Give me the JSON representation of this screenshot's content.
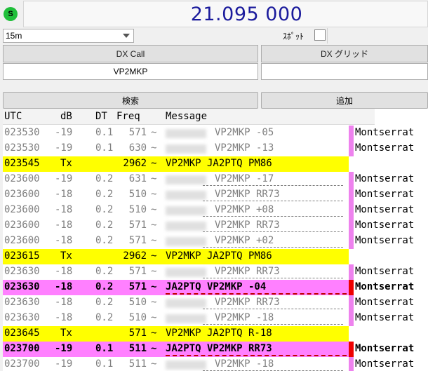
{
  "freq": {
    "indicator": "S",
    "value": "21.095 000"
  },
  "band": {
    "selected": "15m"
  },
  "spot": {
    "label": "ｽﾎﾟｯﾄ"
  },
  "dx": {
    "call_label": "DX Call",
    "grid_label": "DX グリッド",
    "call_value": "VP2MKP",
    "grid_value": ""
  },
  "actions": {
    "search": "検索",
    "add": "追加"
  },
  "table": {
    "headers": [
      "UTC",
      "dB",
      "DT",
      "Freq",
      "Message"
    ],
    "rows": [
      {
        "utc": "023530",
        "db": "-19",
        "dt": "0.1",
        "freq": "571",
        "sep": "~",
        "msg": "VP2MKP -05",
        "country": "Montserrat",
        "style": "normal",
        "bar": "#ee82ee",
        "underline": false
      },
      {
        "utc": "023530",
        "db": "-19",
        "dt": "0.1",
        "freq": "630",
        "sep": "~",
        "msg": "VP2MKP -13",
        "country": "Montserrat",
        "style": "normal",
        "bar": "#ee82ee",
        "underline": false
      },
      {
        "utc": "023545",
        "db": "Tx",
        "dt": "",
        "freq": "2962",
        "sep": "~",
        "msg": "VP2MKP JA2PTQ PM86",
        "country": "",
        "style": "yellow",
        "bar": "",
        "underline": false
      },
      {
        "utc": "023600",
        "db": "-19",
        "dt": "0.2",
        "freq": "631",
        "sep": "~",
        "msg": "VP2MKP -17",
        "country": "Montserrat",
        "style": "normal",
        "bar": "#ee82ee",
        "underline": true
      },
      {
        "utc": "023600",
        "db": "-18",
        "dt": "0.2",
        "freq": "510",
        "sep": "~",
        "msg": "VP2MKP RR73",
        "country": "Montserrat",
        "style": "normal",
        "bar": "#ee82ee",
        "underline": true
      },
      {
        "utc": "023600",
        "db": "-18",
        "dt": "0.2",
        "freq": "510",
        "sep": "~",
        "msg": "VP2MKP +08",
        "country": "Montserrat",
        "style": "normal",
        "bar": "#ee82ee",
        "underline": true
      },
      {
        "utc": "023600",
        "db": "-18",
        "dt": "0.2",
        "freq": "571",
        "sep": "~",
        "msg": "VP2MKP RR73",
        "country": "Montserrat",
        "style": "normal",
        "bar": "#ee82ee",
        "underline": true
      },
      {
        "utc": "023600",
        "db": "-18",
        "dt": "0.2",
        "freq": "571",
        "sep": "~",
        "msg": "VP2MKP +02",
        "country": "Montserrat",
        "style": "normal",
        "bar": "#ee82ee",
        "underline": true
      },
      {
        "utc": "023615",
        "db": "Tx",
        "dt": "",
        "freq": "2962",
        "sep": "~",
        "msg": "VP2MKP JA2PTQ PM86",
        "country": "",
        "style": "yellow",
        "bar": "",
        "underline": false
      },
      {
        "utc": "023630",
        "db": "-18",
        "dt": "0.2",
        "freq": "571",
        "sep": "~",
        "msg": "VP2MKP RR73",
        "country": "Montserrat",
        "style": "normal",
        "bar": "#ee82ee",
        "underline": true
      },
      {
        "utc": "023630",
        "db": "-18",
        "dt": "0.2",
        "freq": "571",
        "sep": "~",
        "msg": "JA2PTQ VP2MKP -04",
        "country": "Montserrat",
        "style": "pink",
        "bar": "#ee0000",
        "underline": true
      },
      {
        "utc": "023630",
        "db": "-18",
        "dt": "0.2",
        "freq": "510",
        "sep": "~",
        "msg": "VP2MKP RR73",
        "country": "Montserrat",
        "style": "normal",
        "bar": "#ee82ee",
        "underline": true
      },
      {
        "utc": "023630",
        "db": "-18",
        "dt": "0.2",
        "freq": "510",
        "sep": "~",
        "msg": "VP2MKP -18",
        "country": "Montserrat",
        "style": "normal",
        "bar": "#ee82ee",
        "underline": true
      },
      {
        "utc": "023645",
        "db": "Tx",
        "dt": "",
        "freq": "571",
        "sep": "~",
        "msg": "VP2MKP JA2PTQ R-18",
        "country": "",
        "style": "yellow",
        "bar": "",
        "underline": false
      },
      {
        "utc": "023700",
        "db": "-19",
        "dt": "0.1",
        "freq": "511",
        "sep": "~",
        "msg": "JA2PTQ VP2MKP RR73",
        "country": "Montserrat",
        "style": "pink",
        "bar": "#ee0000",
        "underline": true
      },
      {
        "utc": "023700",
        "db": "-19",
        "dt": "0.1",
        "freq": "511",
        "sep": "~",
        "msg": "VP2MKP -18",
        "country": "Montserrat",
        "style": "normal",
        "bar": "#ee82ee",
        "underline": true
      }
    ]
  }
}
